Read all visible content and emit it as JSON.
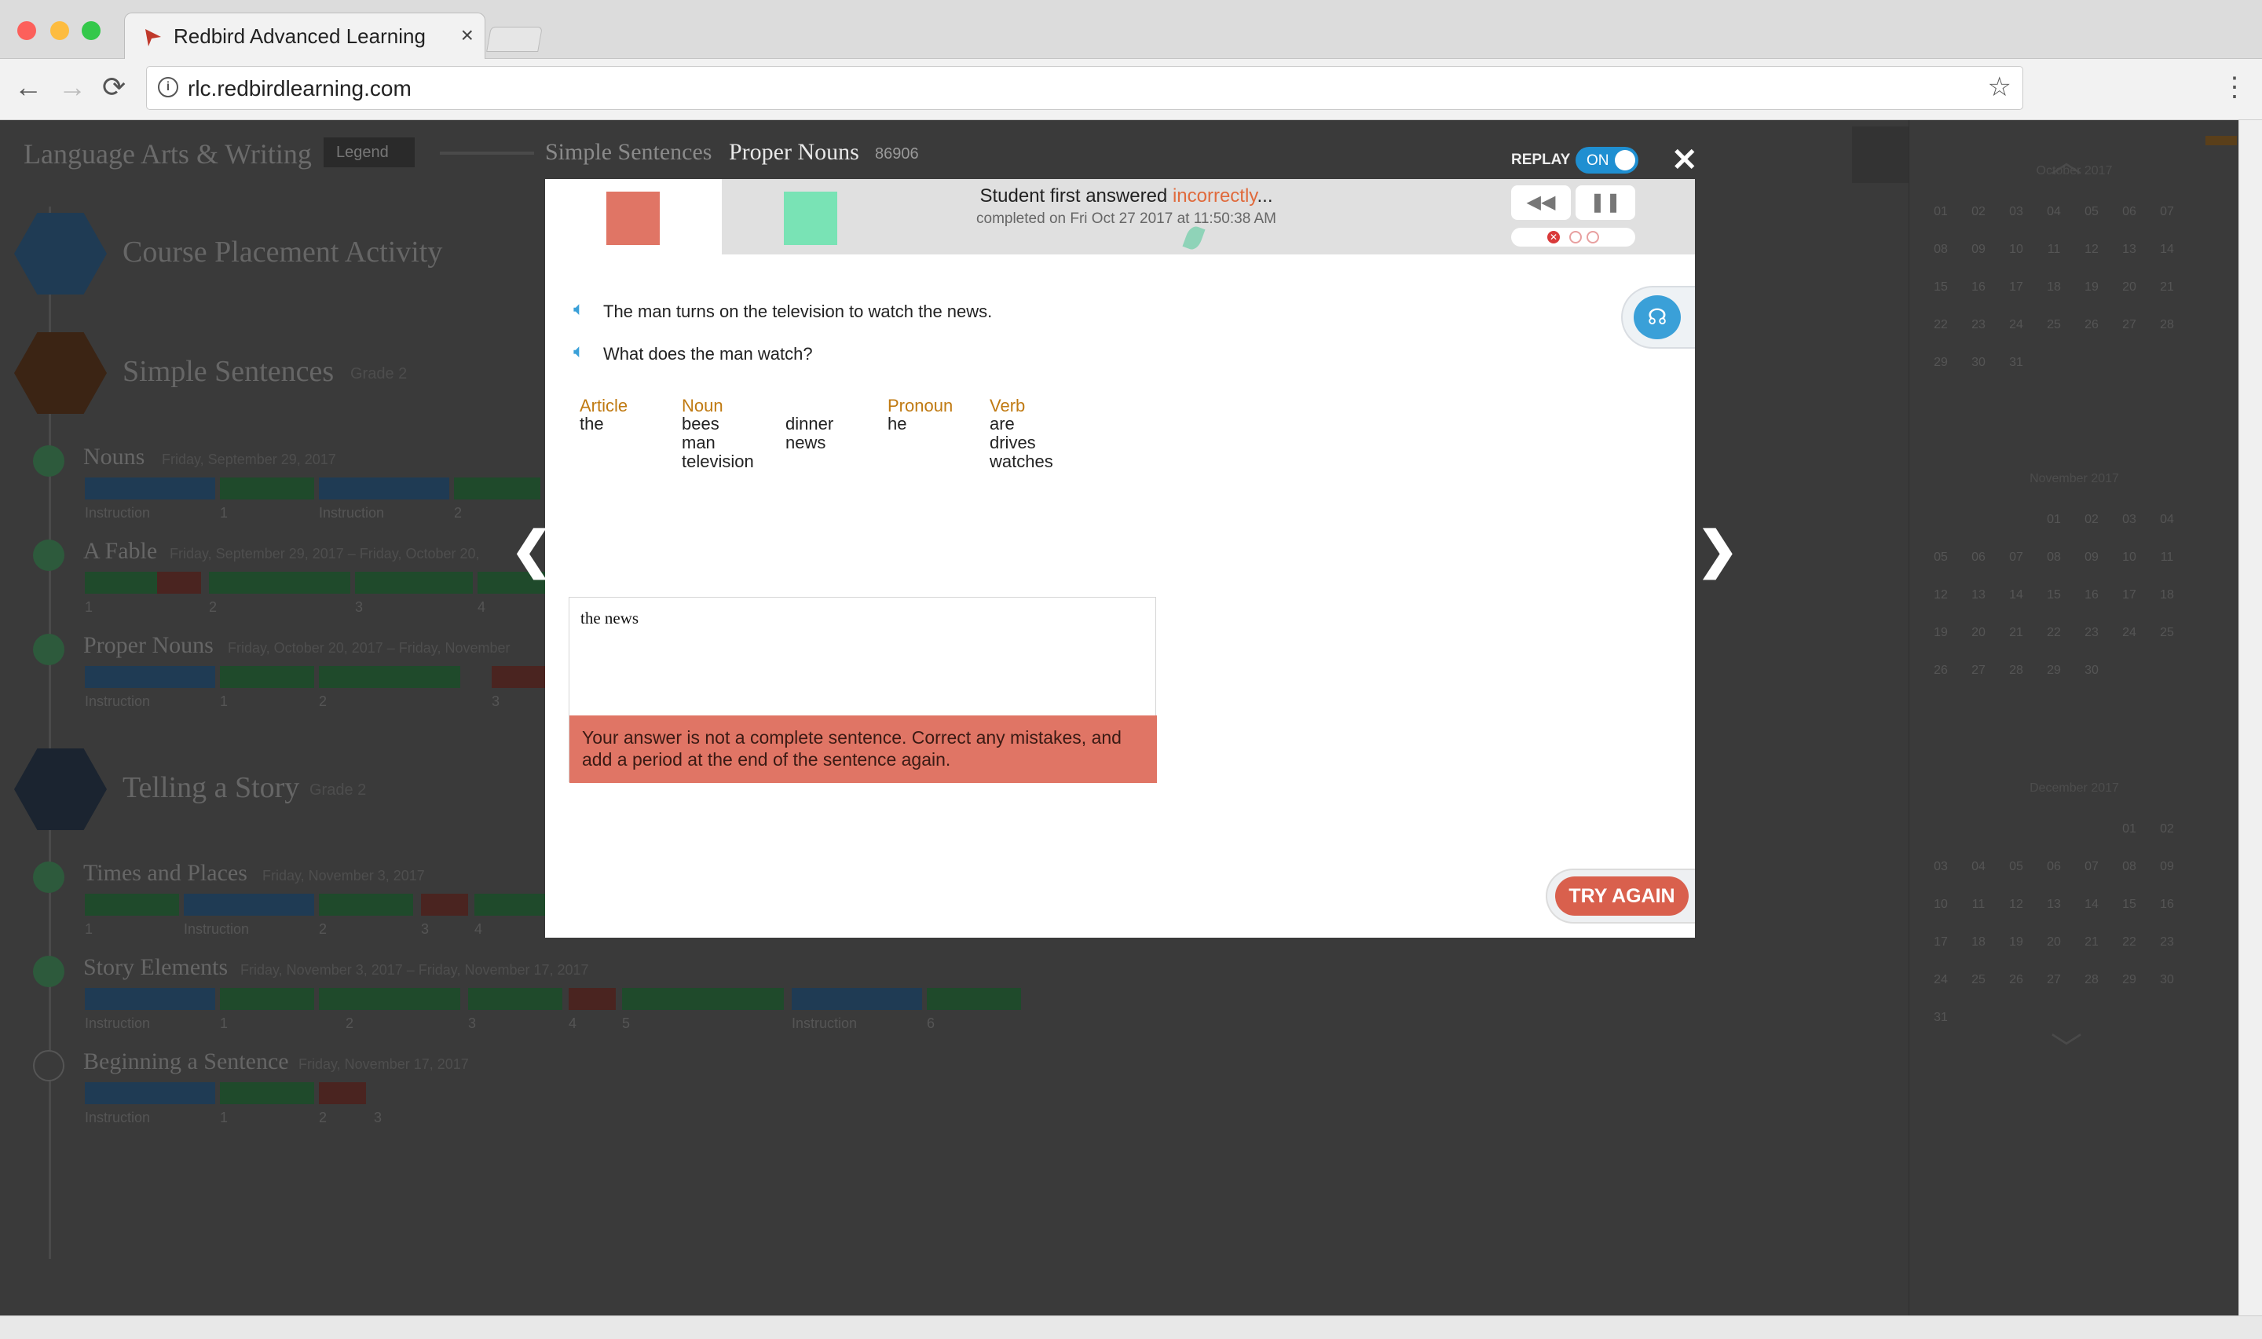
{
  "browser": {
    "tab_title": "Redbird Advanced Learning",
    "tab_close": "×",
    "url": "rlc.redbirdlearning.com",
    "back": "←",
    "forward": "→",
    "reload": "⟳",
    "star": "☆",
    "menu": "⋮",
    "info": "i",
    "colors": {
      "close": "#fc605b",
      "minimize": "#fdbc40",
      "maximize": "#34c84a",
      "brand": "#c0392b"
    }
  },
  "background_app": {
    "title": "Language Arts & Writing",
    "legend_label": "Legend",
    "units": [
      {
        "title": "Course Placement Activity",
        "grade": ""
      },
      {
        "title": "Simple Sentences",
        "grade": "Grade 2",
        "lessons": [
          {
            "name": "Nouns",
            "date": "Friday, September 29, 2017",
            "labels": [
              "Instruction",
              "1",
              "Instruction",
              "2"
            ]
          },
          {
            "name": "A Fable",
            "date": "Friday, September 29, 2017 – Friday, October 20,",
            "labels": [
              "1",
              "2",
              "3",
              "4"
            ]
          },
          {
            "name": "Proper Nouns",
            "date": "Friday, October 20, 2017 – Friday, November",
            "labels": [
              "Instruction",
              "1",
              "2",
              "3"
            ]
          }
        ]
      },
      {
        "title": "Telling a Story",
        "grade": "Grade 2",
        "lessons": [
          {
            "name": "Times and Places",
            "date": "Friday, November 3, 2017",
            "labels": [
              "1",
              "Instruction",
              "2",
              "3",
              "4"
            ]
          },
          {
            "name": "Story Elements",
            "date": "Friday, November 3, 2017 – Friday, November 17, 2017",
            "labels": [
              "Instruction",
              "1",
              "2",
              "3",
              "4",
              "5",
              "Instruction",
              "6"
            ]
          },
          {
            "name": "Beginning a Sentence",
            "date": "Friday, November 17, 2017",
            "labels": [
              "Instruction",
              "1",
              "2",
              "3"
            ]
          }
        ]
      }
    ],
    "calendar": {
      "months": [
        {
          "name": "October 2017",
          "days": [
            "01",
            "02",
            "03",
            "04",
            "05",
            "06",
            "07",
            "08",
            "09",
            "10",
            "11",
            "12",
            "13",
            "14",
            "15",
            "16",
            "17",
            "18",
            "19",
            "20",
            "21",
            "22",
            "23",
            "24",
            "25",
            "26",
            "27",
            "28",
            "29",
            "30",
            "31"
          ]
        },
        {
          "name": "November 2017",
          "days": [
            "01",
            "02",
            "03",
            "04",
            "05",
            "06",
            "07",
            "08",
            "09",
            "10",
            "11",
            "12",
            "13",
            "14",
            "15",
            "16",
            "17",
            "18",
            "19",
            "20",
            "21",
            "22",
            "23",
            "24",
            "25",
            "26",
            "27",
            "28",
            "29",
            "30"
          ]
        },
        {
          "name": "December 2017",
          "days": [
            "01",
            "02",
            "03",
            "04",
            "05",
            "06",
            "07",
            "08",
            "09",
            "10",
            "11",
            "12",
            "13",
            "14",
            "15",
            "16",
            "17",
            "18",
            "19",
            "20",
            "21",
            "22",
            "23",
            "24",
            "25",
            "26",
            "27",
            "28",
            "29",
            "30",
            "31"
          ]
        }
      ]
    }
  },
  "modal": {
    "parent_unit": "Simple Sentences",
    "lesson": "Proper Nouns",
    "activity_id": "86906",
    "replay_label": "REPLAY",
    "replay_state": "ON",
    "close": "✕",
    "status_prefix": "Student first answered ",
    "status_word": "incorrectly",
    "status_suffix": "...",
    "completed": "completed on Fri Oct 27 2017 at 11:50:38 AM",
    "rewind": "◀◀",
    "pause": "❚❚",
    "prompt": "The man turns on the television to watch the news.",
    "question": "What does the man watch?",
    "word_bank": [
      {
        "head": "Article",
        "words": [
          "the"
        ]
      },
      {
        "head": "Noun",
        "words": [
          "bees",
          "man",
          "television"
        ]
      },
      {
        "head": "",
        "words": [
          "dinner",
          "news"
        ]
      },
      {
        "head": "Pronoun",
        "words": [
          "he"
        ]
      },
      {
        "head": "Verb",
        "words": [
          "are",
          "drives",
          "watches"
        ]
      }
    ],
    "answer": "the news",
    "error": "Your answer is not a complete sentence. Correct any mistakes, and add a period at the end of the sentence again.",
    "try_again": "TRY AGAIN",
    "prev": "❮",
    "next": "❯",
    "colors": {
      "incorrect": "#e07565",
      "correct": "#79e3b5",
      "accent": "#1f8fd1",
      "word_head": "#c07a12"
    }
  }
}
